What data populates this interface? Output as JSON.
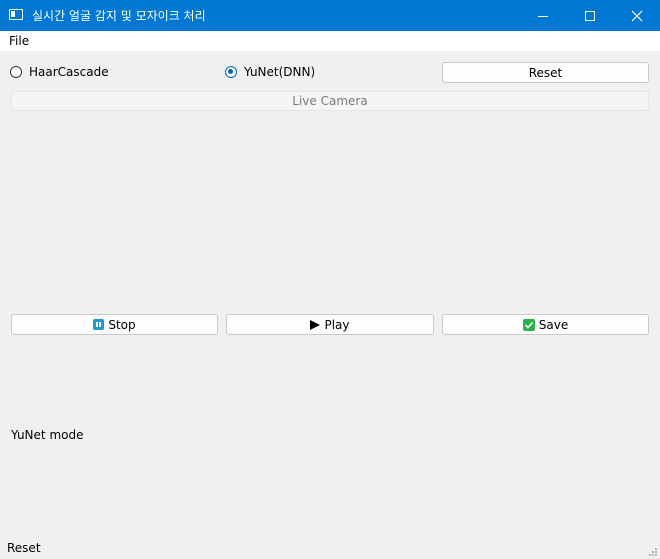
{
  "window": {
    "title": "실시간 얼굴 감지 및 모자이크 처리",
    "icon": "window-app-icon",
    "controls": [
      "minimize-icon",
      "maximize-icon",
      "close-icon"
    ]
  },
  "menubar": {
    "file": "File"
  },
  "detector": {
    "options": [
      {
        "label": "HaarCascade",
        "checked": false
      },
      {
        "label": "YuNet(DNN)",
        "checked": true
      }
    ],
    "reset_label": "Reset"
  },
  "camera": {
    "label": "Live Camera"
  },
  "controls": {
    "stop_label": "Stop",
    "play_label": "Play",
    "save_label": "Save"
  },
  "mode_text": "YuNet mode",
  "status_text": "Reset",
  "colors": {
    "titlebar": "#0078d4",
    "radio_accent": "#0067c0",
    "stop_icon": "#1a9ad6",
    "save_icon": "#2ab24c"
  }
}
